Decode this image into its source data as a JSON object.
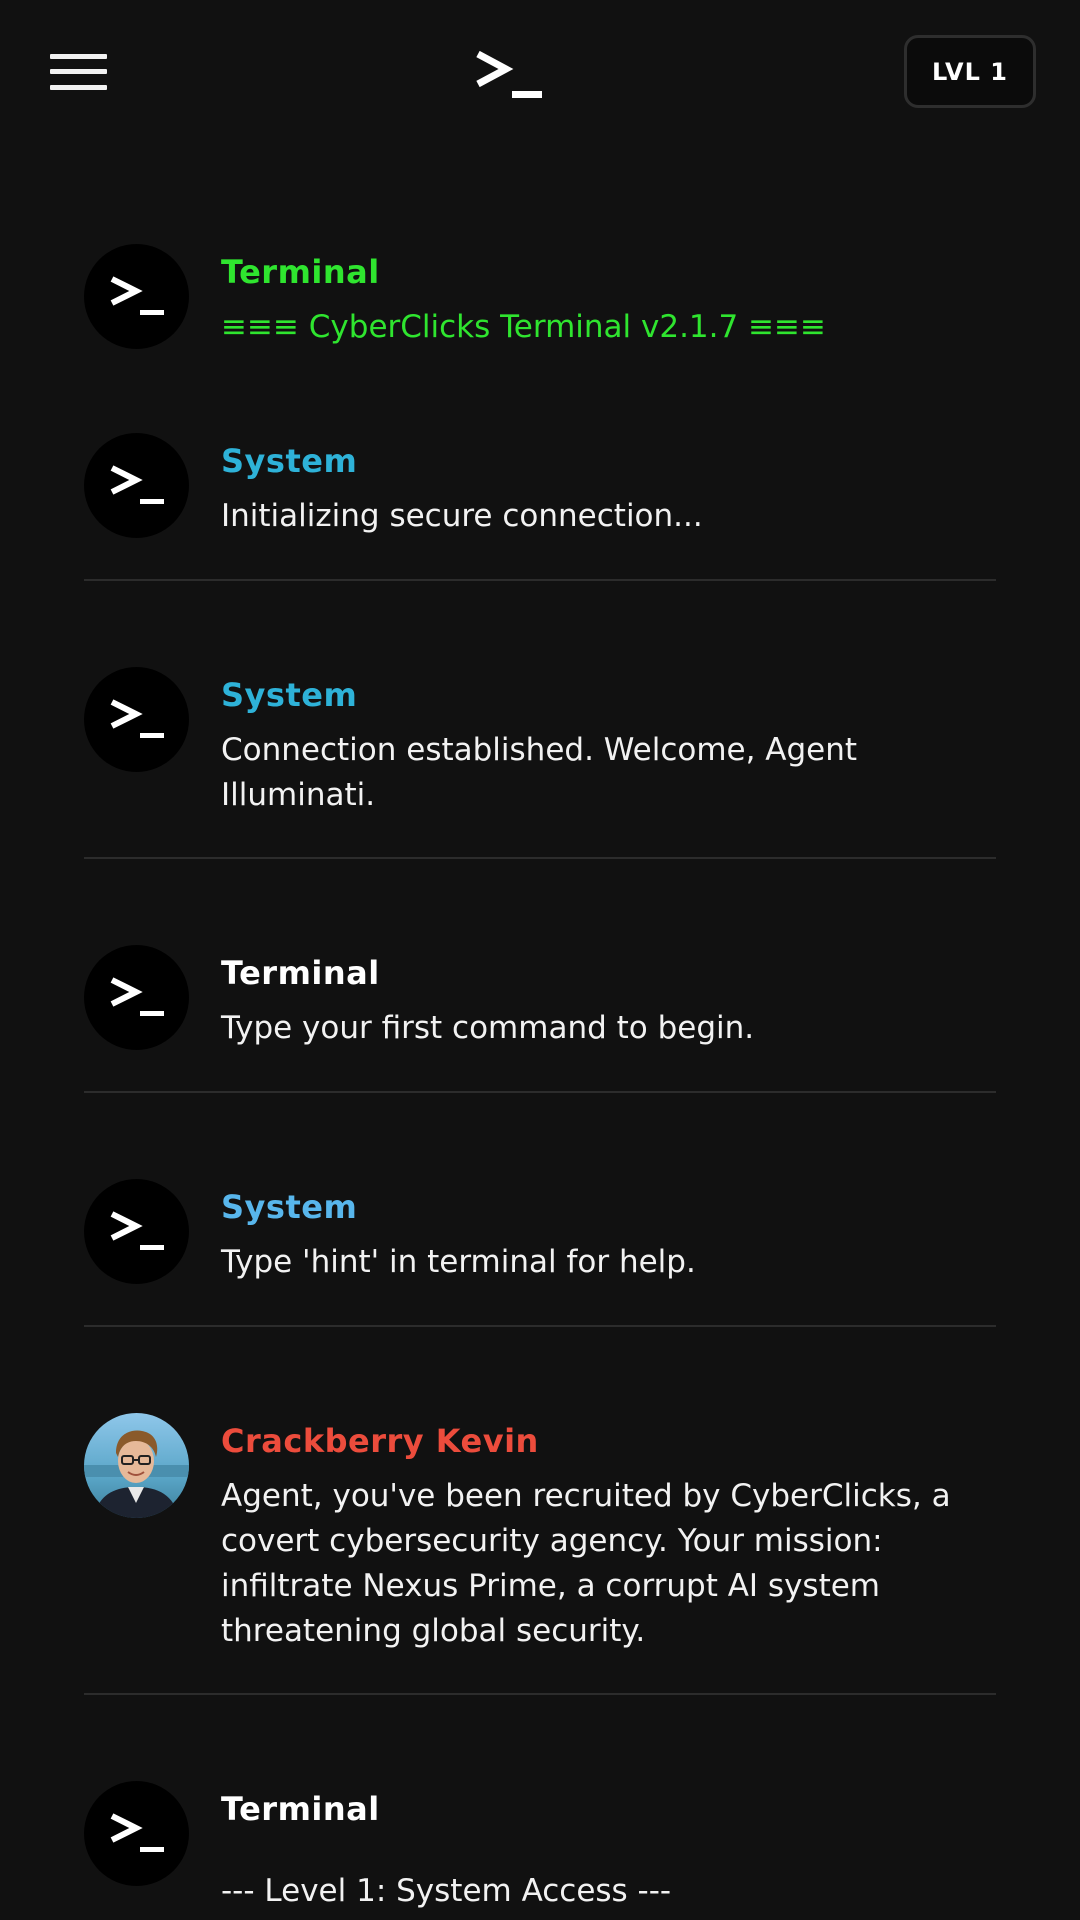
{
  "header": {
    "menu_icon": "hamburger-menu-icon",
    "logo_icon": "terminal-prompt-icon",
    "level_label": "LVL 1"
  },
  "colors": {
    "background": "#111111",
    "terminal_green": "#2fe52f",
    "system_cyan": "#2eb2d8",
    "system_blue": "#58b6ec",
    "kevin_red": "#ec4c3c",
    "text": "#f2f2f2"
  },
  "messages": [
    {
      "sender": "Terminal",
      "sender_color": "#2fe52f",
      "text": "≡≡≡ CyberClicks Terminal v2.1.7 ≡≡≡",
      "text_color": "#2fe52f",
      "avatar": "terminal-prompt-icon"
    },
    {
      "sender": "System",
      "sender_color": "#2eb2d8",
      "text": "Initializing secure connection...",
      "avatar": "terminal-prompt-icon"
    },
    {
      "sender": "System",
      "sender_color": "#2eb2d8",
      "text": "Connection established. Welcome, Agent Illuminati.",
      "avatar": "terminal-prompt-icon"
    },
    {
      "sender": "Terminal",
      "sender_color": "#ffffff",
      "text": "Type your first command to begin.",
      "avatar": "terminal-prompt-icon"
    },
    {
      "sender": "System",
      "sender_color": "#58b6ec",
      "text": "Type 'hint' in terminal for help.",
      "avatar": "terminal-prompt-icon"
    },
    {
      "sender": "Crackberry Kevin",
      "sender_color": "#ec4c3c",
      "text": "Agent, you've been recruited by CyberClicks, a covert cybersecurity agency. Your mission: infiltrate Nexus Prime, a corrupt AI system threatening global security.",
      "avatar": "kevin-photo-avatar"
    },
    {
      "sender": "Terminal",
      "sender_color": "#ffffff",
      "text": "--- Level 1: System Access ---",
      "avatar": "terminal-prompt-icon"
    }
  ]
}
